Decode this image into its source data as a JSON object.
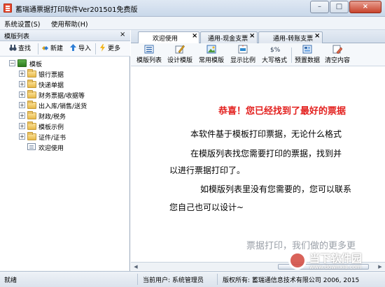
{
  "window": {
    "title": "蓄瑞通票据打印软件Ver201501免费版",
    "controls": {
      "minimize": "–",
      "maximize": "□",
      "close": "×"
    }
  },
  "menu": {
    "items": [
      "系统设置(S)",
      "使用帮助(H)"
    ]
  },
  "left_panel": {
    "title": "模版列表",
    "close": "×",
    "toolbar": [
      "查找",
      "新建",
      "导入",
      "更多"
    ],
    "tree": {
      "root": "模板",
      "items": [
        "银行票据",
        "快递单据",
        "财务票据/收据等",
        "出入库/销售/送货",
        "财政/税务",
        "模板示例",
        "证件/证书"
      ],
      "leaf": "欢迎使用"
    }
  },
  "tabs": [
    {
      "label": "欢迎使用",
      "active": true
    },
    {
      "label": "通用-现金支票",
      "active": false
    },
    {
      "label": "通用-转账支票",
      "active": false
    }
  ],
  "tab_close": "×",
  "toolbar": [
    "模版列表",
    "设计模版",
    "常用模版",
    "显示比例",
    "大写格式",
    "预置数据",
    "清空内容"
  ],
  "content": {
    "headline": "恭喜！您已经找到了最好的票据",
    "line1": "本软件基于模板打印票据，无论什么格式",
    "line2": "在模版列表找您需要打印的票据，找到并",
    "line3": "以进行票据打印了。",
    "line4": "如模版列表里没有您需要的，您可以联系",
    "line5": "您自己也可以设计~",
    "tagline": "票据打印，我们做的更多更"
  },
  "status": {
    "ready": "就绪",
    "user": "当前用户: 系统管理员",
    "copyright": "版权所有: 蓄瑞通信息技术有限公司 2006, 2015"
  },
  "watermark": {
    "text": "当下软件园",
    "url": "www.downxia.com"
  },
  "colors": {
    "headline": "#e3201e",
    "accent": "#2d62a8"
  }
}
